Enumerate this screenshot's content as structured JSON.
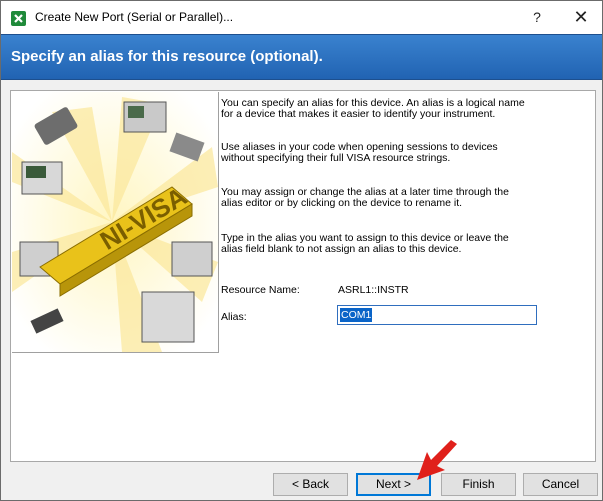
{
  "window": {
    "title": "Create New Port (Serial or Parallel)...",
    "help_label": "?",
    "close_label": "✕"
  },
  "banner": {
    "title": "Specify an alias for this resource (optional)."
  },
  "illustration": {
    "logo_text": "NI-VISA"
  },
  "paragraphs": [
    [
      "You can specify an alias for this device. An alias is a logical name",
      "for a device that makes it easier to identify your instrument."
    ],
    [
      "Use aliases in your code when opening sessions to devices",
      "without specifying their full VISA resource strings."
    ],
    [
      "You may assign or change the alias at a later time through the",
      "alias editor or by clicking on the device to rename it."
    ],
    [
      "Type in the alias you want to assign to this device or leave the",
      "alias field blank to not assign an alias to this device."
    ]
  ],
  "form": {
    "resource_name_label": "Resource Name:",
    "resource_name_value": "ASRL1::INSTR",
    "alias_label": "Alias:",
    "alias_value": "COM1"
  },
  "buttons": {
    "back": "< Back",
    "next": "Next >",
    "finish": "Finish",
    "cancel": "Cancel"
  },
  "colors": {
    "banner": "#2a6fc0",
    "selection": "#0a64c8",
    "pointer_arrow": "#e0201b"
  }
}
